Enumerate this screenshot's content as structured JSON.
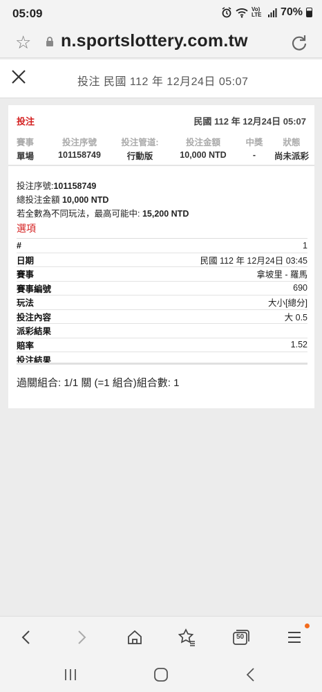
{
  "status_bar": {
    "time": "05:09",
    "battery": "70%",
    "lte_label": "Vo) LTE"
  },
  "browser": {
    "url": "n.sportslottery.com.tw"
  },
  "header": {
    "title": "投注 民國 112 年 12月24日 05:07"
  },
  "ticket": {
    "label": "投注",
    "date": "民國 112 年 12月24日 05:07",
    "summary_headers": [
      "賽事",
      "投注序號",
      "投注管道:",
      "投注金額",
      "中獎",
      "狀態"
    ],
    "summary_values": [
      "單場",
      "101158749",
      "行動版",
      "10,000 NTD",
      "-",
      "尚未派彩"
    ],
    "serial_label": "投注序號:",
    "serial_value": "101158749",
    "total_label": "總投注金額 ",
    "total_value": "10,000 NTD",
    "max_label": "若全數為不同玩法，最高可能中: ",
    "max_value": "15,200 NTD",
    "options_title": "選項",
    "details": [
      {
        "key": "#",
        "value": "1"
      },
      {
        "key": "日期",
        "value": "民國 112 年 12月24日 03:45"
      },
      {
        "key": "賽事",
        "value": "拿坡里 - 羅馬"
      },
      {
        "key": "賽事編號",
        "value": "690"
      },
      {
        "key": "玩法",
        "value": "大小[總分]"
      },
      {
        "key": "投注內容",
        "value": "大 0.5"
      },
      {
        "key": "派彩結果",
        "value": ""
      },
      {
        "key": "賠率",
        "value": "1.52"
      },
      {
        "key": "投注結果",
        "value": ""
      }
    ],
    "combination": "過關組合: 1/1 關 (=1 組合)組合數: 1"
  },
  "toolbar": {
    "tabs_count": "50"
  },
  "colors": {
    "accent_red": "#d42020",
    "notification_dot": "#f26b1d"
  }
}
